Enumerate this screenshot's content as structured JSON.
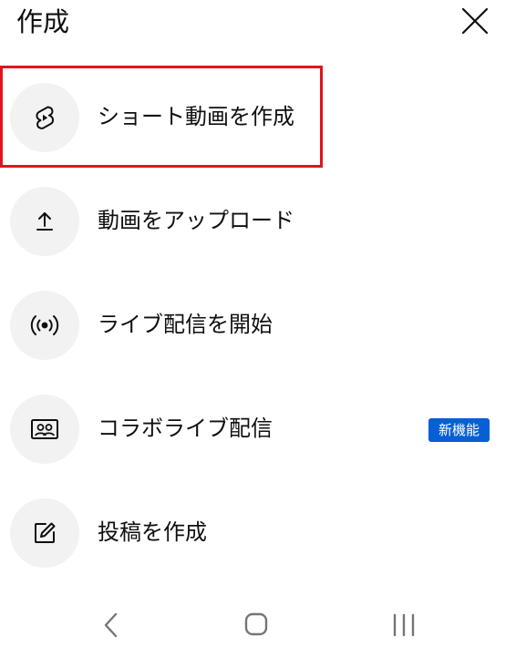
{
  "header": {
    "title": "作成"
  },
  "menu": {
    "items": [
      {
        "label": "ショート動画を作成",
        "icon": "shorts-icon"
      },
      {
        "label": "動画をアップロード",
        "icon": "upload-icon"
      },
      {
        "label": "ライブ配信を開始",
        "icon": "live-broadcast-icon"
      },
      {
        "label": "コラボライブ配信",
        "icon": "collab-live-icon",
        "badge": "新機能"
      },
      {
        "label": "投稿を作成",
        "icon": "edit-post-icon"
      }
    ]
  },
  "colors": {
    "highlight_border": "#e0141f",
    "badge_background": "#065fd4",
    "icon_circle": "#f2f2f2"
  },
  "navbar": {
    "buttons": [
      "back-icon",
      "home-icon",
      "recent-apps-icon"
    ]
  }
}
